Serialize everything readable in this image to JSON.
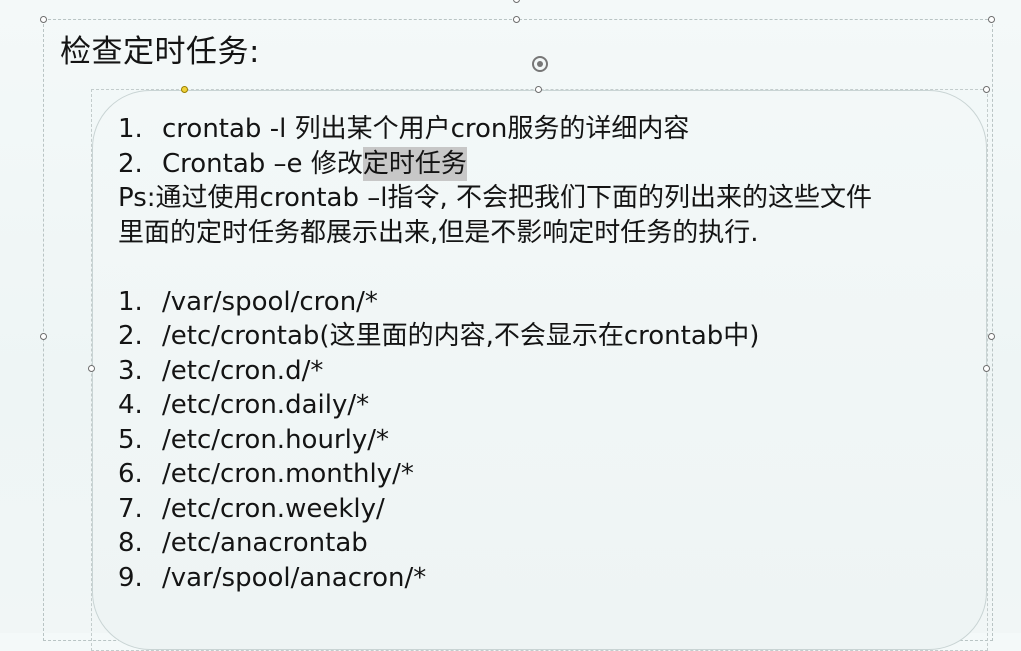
{
  "slide": {
    "title": "检查定时任务:",
    "textbox": {
      "items_top": [
        {
          "num": "1.",
          "text": "crontab -l 列出某个用户cron服务的详细内容"
        },
        {
          "num": "2.",
          "pre": "Crontab –e 修改",
          "highlight": "定时任务"
        }
      ],
      "ps_line1": "Ps:通过使用crontab –l指令, 不会把我们下面的列出来的这些文件",
      "ps_line2": "里面的定时任务都展示出来,但是不影响定时任务的执行.",
      "paths": [
        {
          "num": "1.",
          "text": "/var/spool/cron/*"
        },
        {
          "num": "2.",
          "text": "/etc/crontab(这里面的内容,不会显示在crontab中)"
        },
        {
          "num": "3.",
          "text": "/etc/cron.d/*"
        },
        {
          "num": "4.",
          "text": "/etc/cron.daily/*"
        },
        {
          "num": "5.",
          "text": "/etc/cron.hourly/*"
        },
        {
          "num": "6.",
          "text": "/etc/cron.monthly/*"
        },
        {
          "num": "7.",
          "text": "/etc/cron.weekly/"
        },
        {
          "num": "8.",
          "text": "/etc/anacrontab"
        },
        {
          "num": "9.",
          "text": "/var/spool/anacron/*"
        }
      ]
    }
  }
}
